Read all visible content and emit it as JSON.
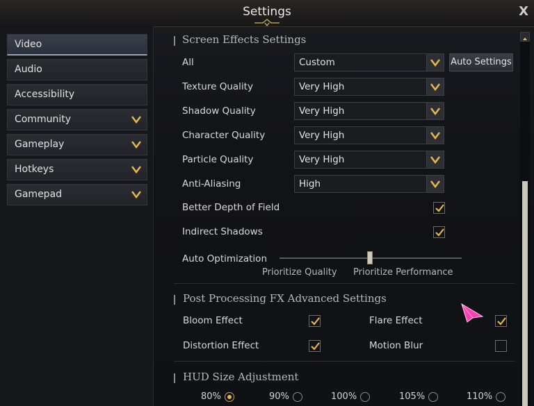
{
  "window": {
    "title": "Settings",
    "close_label": "X"
  },
  "sidebar": {
    "items": [
      {
        "label": "Video",
        "active": true,
        "has_chevron": false
      },
      {
        "label": "Audio",
        "active": false,
        "has_chevron": false
      },
      {
        "label": "Accessibility",
        "active": false,
        "has_chevron": false
      },
      {
        "label": "Community",
        "active": false,
        "has_chevron": true
      },
      {
        "label": "Gameplay",
        "active": false,
        "has_chevron": true
      },
      {
        "label": "Hotkeys",
        "active": false,
        "has_chevron": true
      },
      {
        "label": "Gamepad",
        "active": false,
        "has_chevron": true
      }
    ]
  },
  "screen_effects": {
    "title": "Screen Effects Settings",
    "all": {
      "label": "All",
      "value": "Custom"
    },
    "auto_settings_label": "Auto Settings",
    "texture": {
      "label": "Texture Quality",
      "value": "Very High"
    },
    "shadow": {
      "label": "Shadow Quality",
      "value": "Very High"
    },
    "character": {
      "label": "Character Quality",
      "value": "Very High"
    },
    "particle": {
      "label": "Particle Quality",
      "value": "Very High"
    },
    "anti_aliasing": {
      "label": "Anti-Aliasing",
      "value": "High"
    },
    "depth_of_field": {
      "label": "Better Depth of Field",
      "checked": true
    },
    "indirect_shadows": {
      "label": "Indirect Shadows",
      "checked": true
    },
    "auto_optimization": {
      "label": "Auto Optimization",
      "left_label": "Prioritize Quality",
      "right_label": "Prioritize Performance",
      "value": 0.5
    }
  },
  "post_processing": {
    "title": "Post Processing FX Advanced Settings",
    "bloom": {
      "label": "Bloom Effect",
      "checked": true
    },
    "flare": {
      "label": "Flare Effect",
      "checked": true
    },
    "distortion": {
      "label": "Distortion Effect",
      "checked": true
    },
    "motion_blur": {
      "label": "Motion Blur",
      "checked": false
    }
  },
  "hud": {
    "title": "HUD Size Adjustment",
    "options": [
      {
        "label": "80%",
        "selected": true
      },
      {
        "label": "90%",
        "selected": false
      },
      {
        "label": "100%",
        "selected": false
      },
      {
        "label": "105%",
        "selected": false
      },
      {
        "label": "110%",
        "selected": false
      }
    ]
  },
  "colors": {
    "accent_gold": "#e2b84f",
    "cursor_pink": "#ff3fb4"
  }
}
